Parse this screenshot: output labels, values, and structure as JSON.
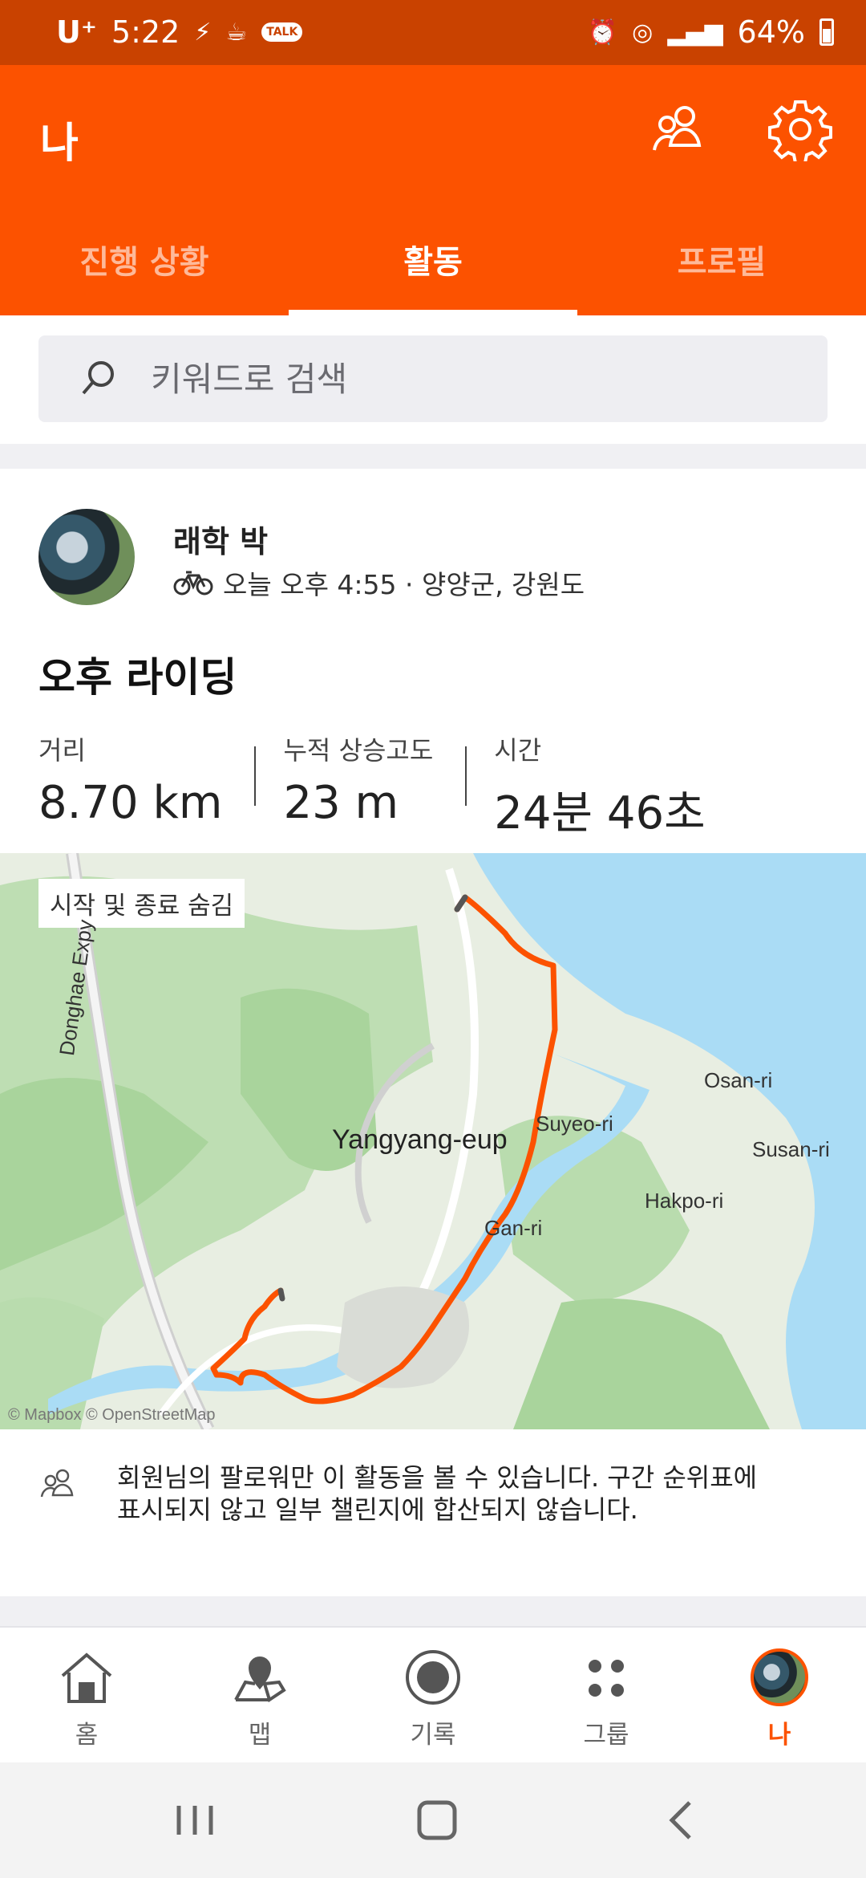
{
  "status_bar": {
    "carrier": "U⁺",
    "time": "5:22",
    "battery": "64%",
    "talk_badge": "TALK"
  },
  "header": {
    "title": "나",
    "tabs": [
      {
        "label": "진행 상황",
        "active": false
      },
      {
        "label": "활동",
        "active": true
      },
      {
        "label": "프로필",
        "active": false
      }
    ]
  },
  "search": {
    "placeholder": "키워드로 검색"
  },
  "activity": {
    "athlete_name": "래학 박",
    "meta": "오늘 오후 4:55 · 양양군, 강원도",
    "title": "오후 라이딩",
    "stats": [
      {
        "label": "거리",
        "value": "8.70 km"
      },
      {
        "label": "누적 상승고도",
        "value": "23 m"
      },
      {
        "label": "시간",
        "value": "24분 46초"
      }
    ]
  },
  "map": {
    "chip": "시작 및 종료 숨김",
    "labels": {
      "expressway": "Donghae Expy",
      "town": "Yangyang-eup",
      "osan": "Osan-ri",
      "suyeo": "Suyeo-ri",
      "susan": "Susan-ri",
      "hakpo": "Hakpo-ri",
      "gan": "Gan-ri"
    },
    "attribution": "© Mapbox © OpenStreetMap",
    "route_color": "#fc5200",
    "water_color": "#aadcf5"
  },
  "notice": {
    "text": "회원님의 팔로워만 이 활동을 볼 수 있습니다. 구간 순위표에 표시되지 않고 일부 챌린지에 합산되지 않습니다."
  },
  "bottom_nav": [
    {
      "label": "홈",
      "icon": "home-icon"
    },
    {
      "label": "맵",
      "icon": "map-pin-icon"
    },
    {
      "label": "기록",
      "icon": "record-icon"
    },
    {
      "label": "그룹",
      "icon": "groups-icon"
    },
    {
      "label": "나",
      "icon": "profile-avatar",
      "active": true
    }
  ],
  "colors": {
    "brand": "#fc5200",
    "status_bar": "#c94200"
  }
}
